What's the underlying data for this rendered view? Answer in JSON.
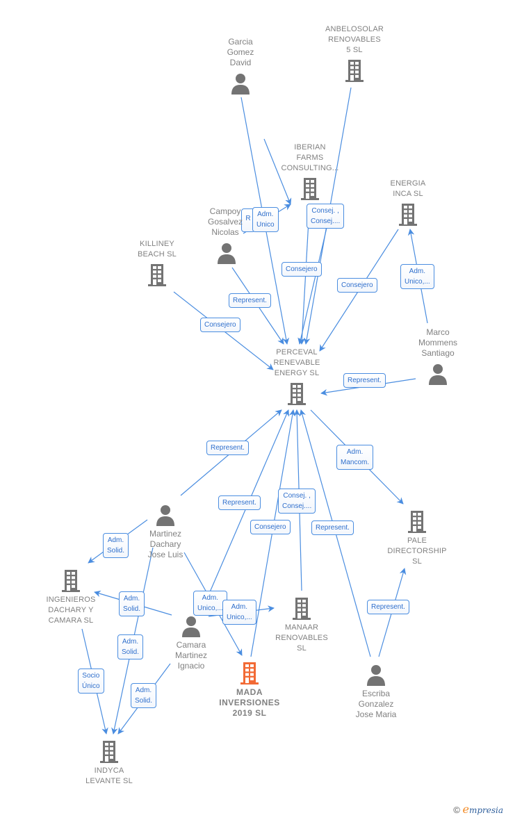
{
  "colors": {
    "edge": "#4a8de0",
    "node_icon": "#737373",
    "main_icon": "#f26a35",
    "label_text": "#808080"
  },
  "nodes": [
    {
      "id": "garcia",
      "type": "person",
      "label": "Garcia\nGomez\nDavid"
    },
    {
      "id": "anbelosolar",
      "type": "company",
      "label": "ANBELOSOLAR\nRENOVABLES\n5  SL"
    },
    {
      "id": "iberian",
      "type": "company",
      "label": "IBERIAN\nFARMS\nCONSULTING..."
    },
    {
      "id": "campoy",
      "type": "person",
      "label": "Campoy\nGosalvez\nNicolas"
    },
    {
      "id": "energia",
      "type": "company",
      "label": "ENERGIA\nINCA  SL"
    },
    {
      "id": "killiney",
      "type": "company",
      "label": "KILLINEY\nBEACH  SL"
    },
    {
      "id": "marco",
      "type": "person",
      "label": "Marco\nMommens\nSantiago"
    },
    {
      "id": "perceval",
      "type": "company",
      "label": "PERCEVAL\nRENEVABLE\nENERGY  SL"
    },
    {
      "id": "martinez",
      "type": "person",
      "label": "Martinez\nDachary\nJose Luis"
    },
    {
      "id": "pale",
      "type": "company",
      "label": "PALE\nDIRECTORSHIP\nSL"
    },
    {
      "id": "ingenieros",
      "type": "company",
      "label": "INGENIEROS\nDACHARY Y\nCAMARA  SL"
    },
    {
      "id": "camara",
      "type": "person",
      "label": "Camara\nMartinez\nIgnacio"
    },
    {
      "id": "manaar",
      "type": "company",
      "label": "MANAAR\nRENOVABLES\nSL"
    },
    {
      "id": "mada",
      "type": "main",
      "label": "MADA\nINVERSIONES\n2019  SL"
    },
    {
      "id": "escriba",
      "type": "person",
      "label": "Escriba\nGonzalez\nJose Maria"
    },
    {
      "id": "indyca",
      "type": "company",
      "label": "INDYCA\nLEVANTE  SL"
    }
  ],
  "edges": [
    {
      "from": "garcia",
      "to": "perceval",
      "label": ""
    },
    {
      "from": "anbelosolar",
      "to": "perceval",
      "label": ""
    },
    {
      "from": "campoy",
      "to": "iberian",
      "label": "R..."
    },
    {
      "from": "garcia",
      "to": "iberian",
      "label": "Adm.\nUnico"
    },
    {
      "from": "iberian",
      "to": "perceval",
      "label": "Consej. ,\nConsej...."
    },
    {
      "from": "iberian",
      "to": "perceval",
      "label": "Consejero"
    },
    {
      "from": "energia",
      "to": "perceval",
      "label": "Consejero"
    },
    {
      "from": "marco",
      "to": "energia",
      "label": "Adm.\nUnico,..."
    },
    {
      "from": "campoy",
      "to": "perceval",
      "label": "Represent."
    },
    {
      "from": "killiney",
      "to": "perceval",
      "label": "Consejero"
    },
    {
      "from": "marco",
      "to": "perceval",
      "label": "Represent."
    },
    {
      "from": "martinez",
      "to": "perceval",
      "label": "Represent."
    },
    {
      "from": "camara",
      "to": "perceval",
      "label": "Represent."
    },
    {
      "from": "mada",
      "to": "perceval",
      "label": "Consejero"
    },
    {
      "from": "manaar",
      "to": "perceval",
      "label": "Consej. ,\nConsej...."
    },
    {
      "from": "escriba",
      "to": "perceval",
      "label": "Represent."
    },
    {
      "from": "perceval",
      "to": "pale",
      "label": "Adm.\nMancom."
    },
    {
      "from": "escriba",
      "to": "pale",
      "label": "Represent."
    },
    {
      "from": "martinez",
      "to": "ingenieros",
      "label": "Adm.\nSolid."
    },
    {
      "from": "camara",
      "to": "ingenieros",
      "label": "Adm.\nSolid."
    },
    {
      "from": "martinez",
      "to": "mada",
      "label": "Adm.\nUnico,..."
    },
    {
      "from": "camara",
      "to": "manaar",
      "label": "Adm.\nUnico,..."
    },
    {
      "from": "ingenieros",
      "to": "indyca",
      "label": "Socio\nÚnico"
    },
    {
      "from": "martinez",
      "to": "indyca",
      "label": "Adm.\nSolid."
    },
    {
      "from": "camara",
      "to": "indyca",
      "label": "Adm.\nSolid."
    }
  ],
  "footer": {
    "copyright": "©",
    "brand_initial": "e",
    "brand_rest": "mpresia"
  }
}
